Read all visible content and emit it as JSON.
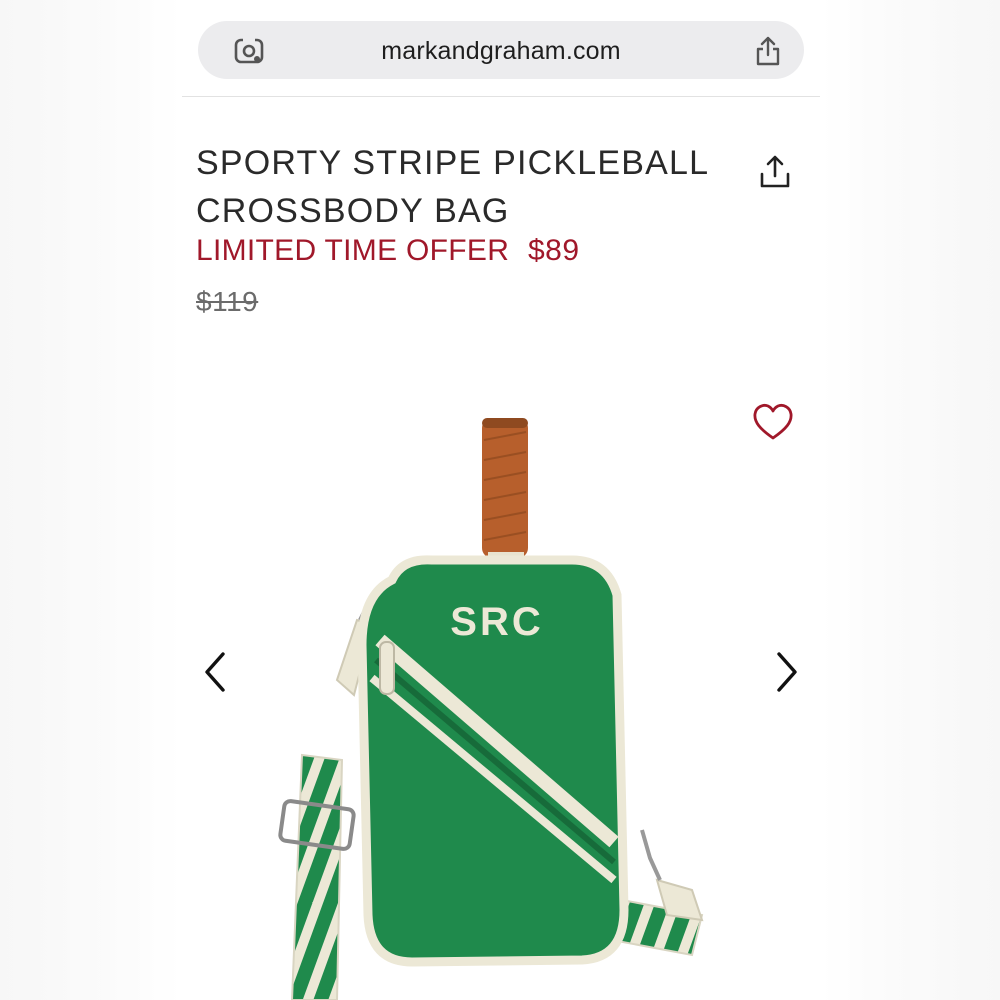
{
  "browser": {
    "url": "markandgraham.com",
    "lens_icon": "camera-lens-icon",
    "share_icon": "share-icon"
  },
  "product": {
    "title_line1": "SPORTY STRIPE PICKLEBALL",
    "title_line2": "CROSSBODY BAG",
    "offer_label": "LIMITED TIME OFFER",
    "sale_price": "$89",
    "original_price": "$119",
    "monogram": "SRC",
    "image_alt": "Green pickleball paddle crossbody bag with cream striped strap and leather-wrapped paddle handle"
  },
  "icons": {
    "share": "share-icon",
    "favorite": "heart-icon",
    "prev": "chevron-left-icon",
    "next": "chevron-right-icon"
  },
  "colors": {
    "accent_red": "#a0182a",
    "bag_green": "#1f8a4c",
    "cream": "#ece8d6",
    "handle_brown": "#b75f2c"
  }
}
